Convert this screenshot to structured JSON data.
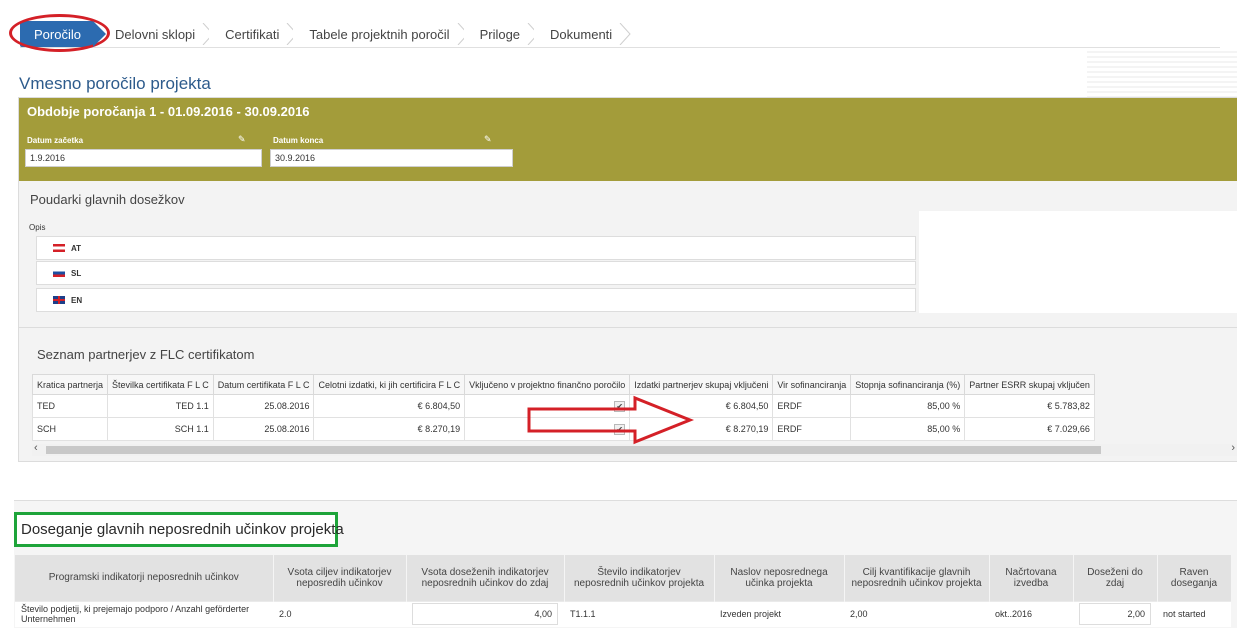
{
  "tabs": [
    {
      "label": "Poročilo"
    },
    {
      "label": "Delovni sklopi"
    },
    {
      "label": "Certifikati"
    },
    {
      "label": "Tabele projektnih poročil"
    },
    {
      "label": "Priloge"
    },
    {
      "label": "Dokumenti"
    }
  ],
  "page_title": "Vmesno poročilo projekta",
  "period": {
    "title": "Obdobje poročanja 1 - 01.09.2016 - 30.09.2016",
    "start_label": "Datum začetka",
    "start_value": "1.9.2016",
    "end_label": "Datum konca",
    "end_value": "30.9.2016"
  },
  "highlights": {
    "title": "Poudarki glavnih dosežkov",
    "opis_label": "Opis",
    "languages": [
      "AT",
      "SL",
      "EN"
    ]
  },
  "partners": {
    "title": "Seznam partnerjev z FLC certifikatom",
    "columns": [
      "Kratica partnerja",
      "Številka certifikata F L C",
      "Datum certifikata F L C",
      "Celotni izdatki, ki jih certificira F L C",
      "Vključeno v projektno finančno poročilo",
      "Izdatki partnerjev skupaj vključeni",
      "Vir sofinanciranja",
      "Stopnja sofinanciranja (%)",
      "Partner ESRR skupaj vključen"
    ],
    "rows": [
      {
        "kratica": "TED",
        "stevilka": "TED 1.1",
        "datum": "25.08.2016",
        "izdatki": "€ 6.804,50",
        "vkljuceno": "✔",
        "skupaj": "€ 6.804,50",
        "vir": "ERDF",
        "stopnja": "85,00 %",
        "esrr": "€ 5.783,82"
      },
      {
        "kratica": "SCH",
        "stevilka": "SCH 1.1",
        "datum": "25.08.2016",
        "izdatki": "€ 8.270,19",
        "vkljuceno": "✔",
        "skupaj": "€ 8.270,19",
        "vir": "ERDF",
        "stopnja": "85,00 %",
        "esrr": "€ 7.029,66"
      }
    ]
  },
  "outputs": {
    "title": "Doseganje glavnih neposrednih učinkov projekta",
    "columns": [
      "Programski indikatorji neposrednih učinkov",
      "Vsota ciljev indikatorjev neposredih učinkov",
      "Vsota doseženih indikatorjev neposrednih učinkov do zdaj",
      "Število indikatorjev neposrednih učinkov projekta",
      "Naslov neposrednega učinka projekta",
      "Cilj kvantifikacije glavnih neposrednih učinkov projekta",
      "Načrtovana izvedba",
      "Doseženi do zdaj",
      "Raven doseganja"
    ],
    "rows": [
      {
        "indikator": "Število podjetij, ki prejemajo podporo / Anzahl geförderter Unternehmen",
        "vsota_ciljev": "2.0",
        "vsota_dosezenih": "4,00",
        "stevilo": "T1.1.1",
        "naslov": "Izveden projekt",
        "cilj": "2,00",
        "nacrtovana": "okt..2016",
        "dosezeni": "2,00",
        "raven": "not started"
      }
    ]
  },
  "colors": {
    "olive": "#a39c3a",
    "tab_active": "#2c6bb0",
    "annotation_red": "#d42027",
    "annotation_green": "#1ea43a"
  }
}
